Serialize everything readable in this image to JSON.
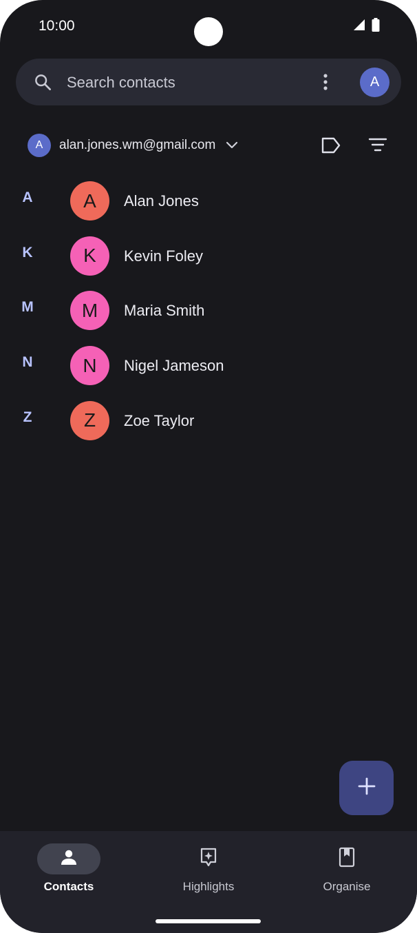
{
  "status_bar": {
    "time": "10:00"
  },
  "search": {
    "placeholder": "Search contacts",
    "account_initial": "A"
  },
  "account": {
    "initial": "A",
    "email": "alan.jones.wm@gmail.com"
  },
  "contacts": [
    {
      "section": "A",
      "initial": "A",
      "name": "Alan Jones",
      "color": "#ef6a5a"
    },
    {
      "section": "K",
      "initial": "K",
      "name": "Kevin Foley",
      "color": "#f561b6"
    },
    {
      "section": "M",
      "initial": "M",
      "name": "Maria Smith",
      "color": "#f561b6"
    },
    {
      "section": "N",
      "initial": "N",
      "name": "Nigel Jameson",
      "color": "#f561b6"
    },
    {
      "section": "Z",
      "initial": "Z",
      "name": "Zoe Taylor",
      "color": "#ef6a5a"
    }
  ],
  "bottom_nav": {
    "items": [
      {
        "label": "Contacts",
        "icon": "person-icon",
        "active": true
      },
      {
        "label": "Highlights",
        "icon": "highlights-icon",
        "active": false
      },
      {
        "label": "Organise",
        "icon": "bookmark-icon",
        "active": false
      }
    ]
  },
  "colors": {
    "background": "#18181c",
    "accent": "#b8c3ff",
    "fab": "#3e4582",
    "avatar": "#5b6cc9"
  }
}
